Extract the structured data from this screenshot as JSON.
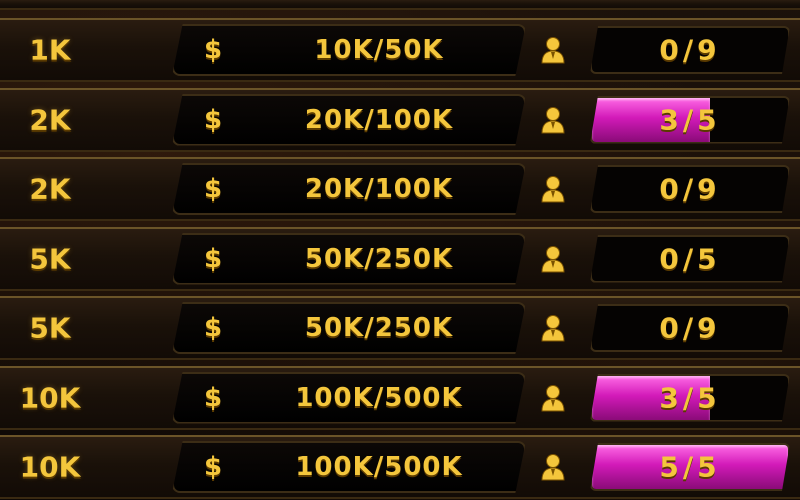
{
  "colors": {
    "gold_text": "#f4c63c",
    "seat_fill": "#d21ab8",
    "row_border": "#6b5428"
  },
  "icons": {
    "currency": "dollar-icon",
    "players": "player-icon"
  },
  "rows": [
    {
      "blind": "1K",
      "currency": "$",
      "stakes": "10K/50K",
      "seats": "0/9",
      "occupancy": 0.0
    },
    {
      "blind": "2K",
      "currency": "$",
      "stakes": "20K/100K",
      "seats": "3/5",
      "occupancy": 0.6
    },
    {
      "blind": "2K",
      "currency": "$",
      "stakes": "20K/100K",
      "seats": "0/9",
      "occupancy": 0.0
    },
    {
      "blind": "5K",
      "currency": "$",
      "stakes": "50K/250K",
      "seats": "0/5",
      "occupancy": 0.0
    },
    {
      "blind": "5K",
      "currency": "$",
      "stakes": "50K/250K",
      "seats": "0/9",
      "occupancy": 0.0
    },
    {
      "blind": "10K",
      "currency": "$",
      "stakes": "100K/500K",
      "seats": "3/5",
      "occupancy": 0.6
    },
    {
      "blind": "10K",
      "currency": "$",
      "stakes": "100K/500K",
      "seats": "5/5",
      "occupancy": 1.0
    }
  ]
}
